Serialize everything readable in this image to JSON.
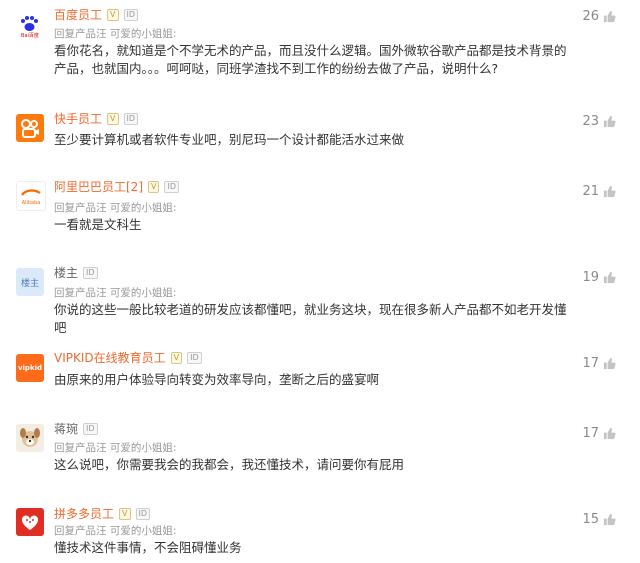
{
  "reply_prefix": "回复产品汪 可爱的小姐姐:",
  "like_color": "#bbbbbb",
  "comments": [
    {
      "avatar_icon": "baidu-logo-icon",
      "avatar_text": "Bai百度",
      "name": "百度员工",
      "badge": "V",
      "reply": "回复产品汪 可爱的小姐姐:",
      "text": "看你花名，就知道是个不学无术的产品，而且没什么逻辑。国外微软谷歌产品都是技术背景的产品，也就国内。。。呵呵哒，同班学渣找不到工作的纷纷去做了产品，说明什么?",
      "likes": "26"
    },
    {
      "avatar_icon": "kuaishou-logo-icon",
      "avatar_text": "",
      "name": "快手员工",
      "badge": "V",
      "text": "至少要计算机或者软件专业吧，别尼玛一个设计都能活水过来做",
      "likes": "23"
    },
    {
      "avatar_icon": "alibaba-logo-icon",
      "avatar_text": "Alibaba",
      "name": "阿里巴巴员工[2]",
      "badge": "V",
      "reply": "回复产品汪 可爱的小姐姐:",
      "text": "一看就是文科生",
      "likes": "21"
    },
    {
      "avatar_icon": "louzhu-avatar-icon",
      "avatar_text": "楼主",
      "name": "楼主",
      "reply": "回复产品汪 可爱的小姐姐:",
      "text": "你说的这些一般比较老道的研发应该都懂吧，就业务这块，现在很多新人产品都不如老开发懂吧",
      "likes": "19"
    },
    {
      "avatar_icon": "vipkid-logo-icon",
      "avatar_text": "vipkid",
      "name": "VIPKID在线教育员工",
      "badge": "V",
      "text": "由原来的用户体验导向转变为效率导向，垄断之后的盛宴啊",
      "likes": "17"
    },
    {
      "avatar_icon": "dog-avatar-icon",
      "avatar_text": "",
      "name": "蒋琬",
      "reply": "回复产品汪 可爱的小姐姐:",
      "text": "这么说吧，你需要我会的我都会，我还懂技术，请问要你有屁用",
      "likes": "17"
    },
    {
      "avatar_icon": "pinduoduo-logo-icon",
      "avatar_text": "",
      "name": "拼多多员工",
      "badge": "V",
      "reply": "回复产品汪 可爱的小姐姐:",
      "text": "懂技术这件事情，不会阻碍懂业务",
      "likes": "15"
    }
  ],
  "id_badge": "ID"
}
